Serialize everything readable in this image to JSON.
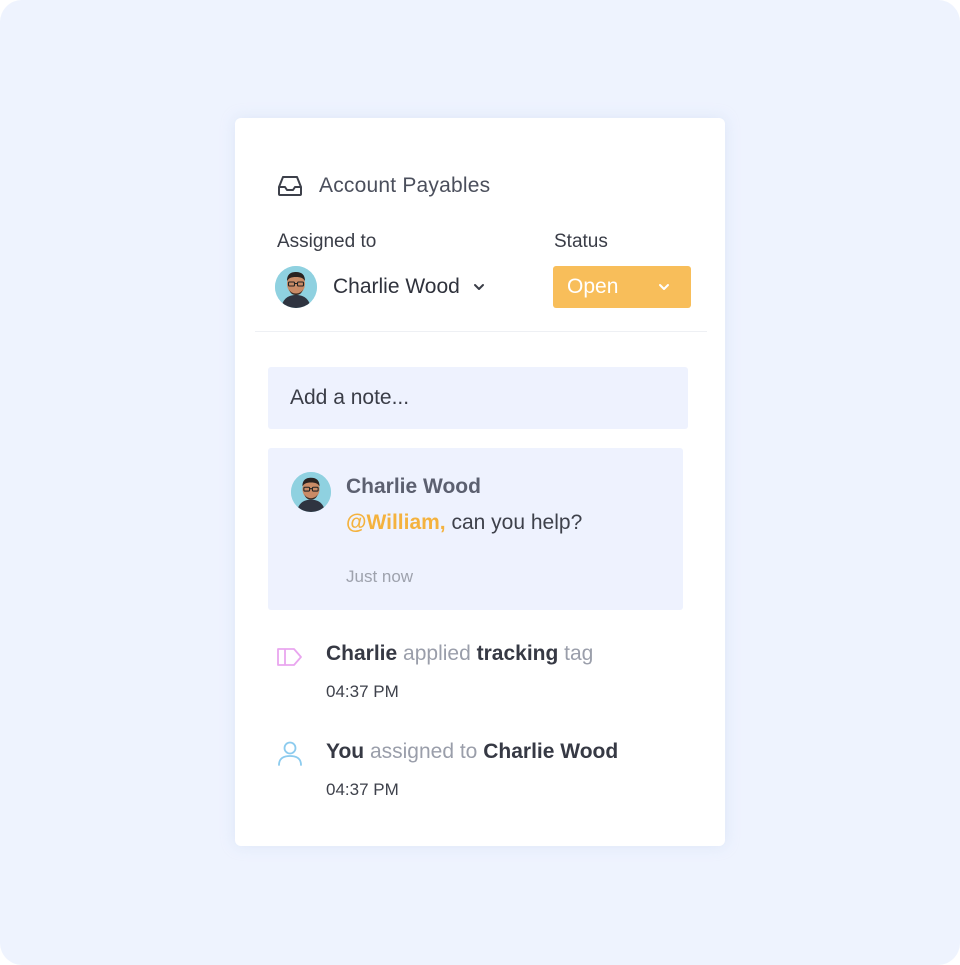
{
  "header": {
    "title": "Account Payables",
    "icon": "inbox-icon"
  },
  "assigned": {
    "label": "Assigned to",
    "name": "Charlie Wood"
  },
  "status": {
    "label": "Status",
    "value": "Open",
    "color": "#f8be5a"
  },
  "note": {
    "placeholder": "Add a note..."
  },
  "comment": {
    "author": "Charlie Wood",
    "mention": "@William,",
    "text": " can you help?",
    "time": "Just now"
  },
  "activities": [
    {
      "icon": "tag-icon",
      "actor": "Charlie",
      "verb": "applied",
      "object": "tracking",
      "suffix": "tag",
      "time": "04:37 PM"
    },
    {
      "icon": "user-icon",
      "actor": "You",
      "verb": "assigned to",
      "object": "Charlie Wood",
      "time": "04:37 PM"
    }
  ],
  "colors": {
    "background": "#eef3fe",
    "accent": "#f8be5a",
    "mention": "#f4b23e",
    "tag_icon": "#e9a6ef",
    "user_icon": "#8ccbee"
  }
}
